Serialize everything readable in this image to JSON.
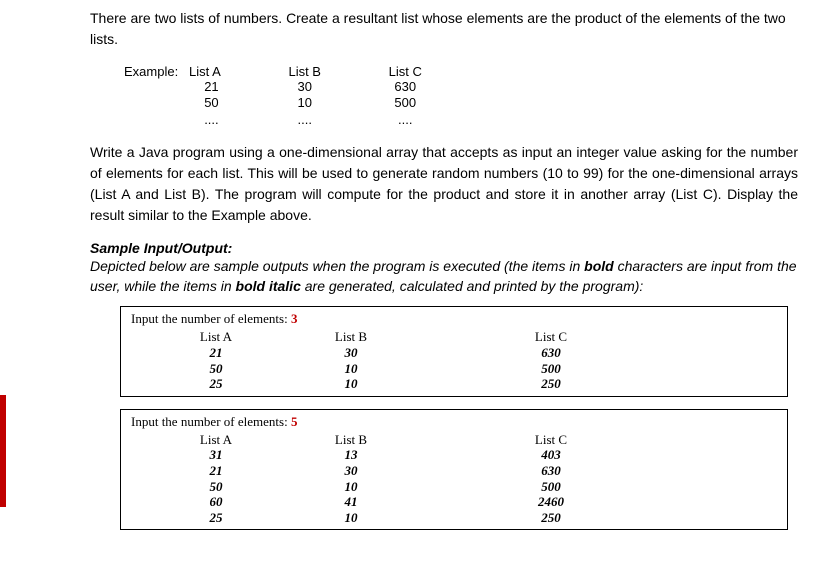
{
  "intro": "There are two lists of numbers. Create a resultant list whose elements are the product of the elements of the two lists.",
  "example": {
    "label": "Example:",
    "cols": [
      {
        "head": "List A",
        "vals": [
          "21",
          "50",
          "...."
        ]
      },
      {
        "head": "List B",
        "vals": [
          "30",
          "10",
          "...."
        ]
      },
      {
        "head": "List C",
        "vals": [
          "630",
          "500",
          "...."
        ]
      }
    ]
  },
  "para2": "Write a Java program using a one-dimensional array that accepts as input an integer value asking for the number of elements for each list. This will be used to generate random numbers (10 to 99) for the one-dimensional arrays (List A and List B). The program will compute for the product and store it in another array (List C). Display the result similar to the Example above.",
  "sio_title": "Sample Input/Output:",
  "sio_desc_a": "Depicted below are sample outputs when the program is executed (the items in ",
  "sio_desc_b": "bold",
  "sio_desc_c": " characters are input from the user, while the items in ",
  "sio_desc_d": "bold italic",
  "sio_desc_e": " are generated, calculated and printed by the program):",
  "samples": [
    {
      "prompt": "Input the number of elements:",
      "input": "3",
      "heads": [
        "List A",
        "List B",
        "List C"
      ],
      "rows": [
        [
          "21",
          "30",
          "630"
        ],
        [
          "50",
          "10",
          "500"
        ],
        [
          "25",
          "10",
          "250"
        ]
      ]
    },
    {
      "prompt": "Input the number of elements:",
      "input": "5",
      "heads": [
        "List A",
        "List B",
        "List C"
      ],
      "rows": [
        [
          "31",
          "13",
          "403"
        ],
        [
          "21",
          "30",
          "630"
        ],
        [
          "50",
          "10",
          "500"
        ],
        [
          "60",
          "41",
          "2460"
        ],
        [
          "25",
          "10",
          "250"
        ]
      ]
    }
  ]
}
